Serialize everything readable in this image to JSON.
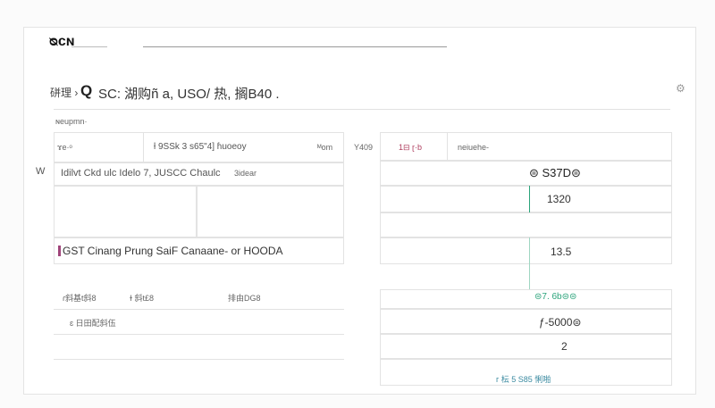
{
  "header": {
    "logo_text": "ᴓᴄɴ"
  },
  "toolbar": {
    "breadcrumb": "硑理 › ",
    "search_icon_glyph": "Q",
    "title_text": "SC: 湖购ñ a, USO/ 热, 搁B40 .",
    "settings_icon_glyph": "⚙"
  },
  "section": {
    "label": "ɴeupmn·"
  },
  "side": {
    "marker": "W"
  },
  "left": {
    "row1": {
      "label": "ɤe·ᵒ",
      "value": "ƚ 9SSk 3 s65\"4] ɦuoeoy",
      "field": "ᴹom"
    },
    "row2": {
      "text": "Idilvt Ckd ulc Idelo 7, JUSCC Chaulc",
      "tag": "3idear"
    },
    "row3": {
      "text": "GST Cinang Prung SaiF Canaane- or HOODA"
    },
    "row4": {
      "col1": "ɾ斜基t斜8",
      "col2": "ɫ 斜t£8",
      "col3": "排由DG8"
    },
    "row5": {
      "text": "ɛ 日田配斜伍"
    }
  },
  "right": {
    "header": {
      "code": "Y409",
      "chip": "1⊟ ɽ·b",
      "label": "neiuehe-"
    },
    "cells": {
      "c1": "⊜ S37D⊜",
      "c2": "1320",
      "c3": "13.5",
      "c4": "⊜7. 6b⊜⊜",
      "c5": "ƒ-5000⊜",
      "c6": "2"
    },
    "footer": {
      "text": "ᴦ 枟 5  S85 悧啪"
    }
  },
  "colors": {
    "accent": "#2aa37a"
  }
}
